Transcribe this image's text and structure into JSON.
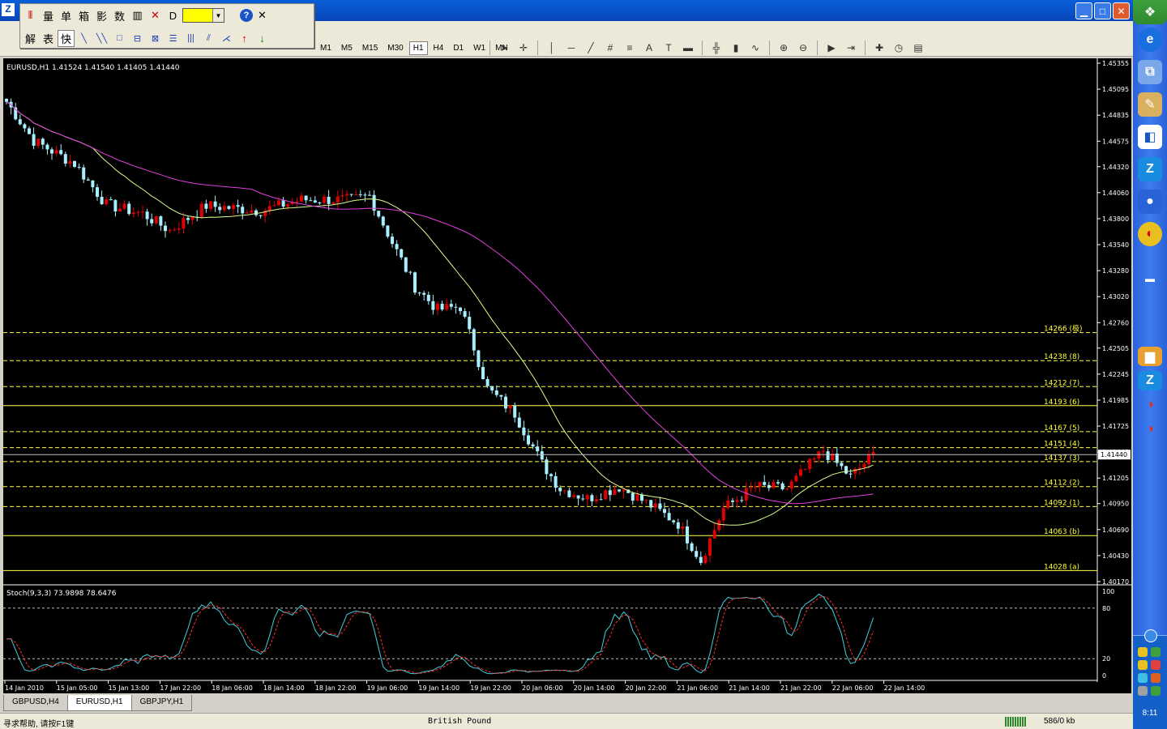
{
  "floating_toolbar": {
    "row1": [
      "量",
      "单",
      "箱",
      "影",
      "数"
    ],
    "row2": [
      "解",
      "表",
      "快"
    ],
    "help": "?",
    "close": "✕"
  },
  "timeframes": [
    "M1",
    "M5",
    "M15",
    "M30",
    "H1",
    "H4",
    "D1",
    "W1",
    "MN"
  ],
  "active_timeframe": "H1",
  "chart": {
    "label": "EURUSD,H1  1.41524 1.41540 1.41405 1.41440",
    "current_price": 1.4144,
    "current_price_label": "1.41440",
    "price_axis": [
      "1.45355",
      "1.45095",
      "1.44835",
      "1.44575",
      "1.44320",
      "1.44060",
      "1.43800",
      "1.43540",
      "1.43280",
      "1.43020",
      "1.42760",
      "1.42505",
      "1.42245",
      "1.41985",
      "1.41725",
      "1.41465",
      "1.41205",
      "1.40950",
      "1.40690",
      "1.40430",
      "1.40170"
    ],
    "price_axis_values": [
      1.45355,
      1.45095,
      1.44835,
      1.44575,
      1.4432,
      1.4406,
      1.438,
      1.4354,
      1.4328,
      1.4302,
      1.4276,
      1.42505,
      1.42245,
      1.41985,
      1.41725,
      1.41465,
      1.41205,
      1.4095,
      1.4069,
      1.4043,
      1.4017
    ],
    "time_axis": [
      "14 Jan 2010",
      "15 Jan 05:00",
      "15 Jan 13:00",
      "17 Jan 22:00",
      "18 Jan 06:00",
      "18 Jan 14:00",
      "18 Jan 22:00",
      "19 Jan 06:00",
      "19 Jan 14:00",
      "19 Jan 22:00",
      "20 Jan 06:00",
      "20 Jan 14:00",
      "20 Jan 22:00",
      "21 Jan 06:00",
      "21 Jan 14:00",
      "21 Jan 22:00",
      "22 Jan 06:00",
      "22 Jan 14:00"
    ],
    "levels": [
      {
        "price": 1.4266,
        "label": "14266 (极)",
        "style": "dash"
      },
      {
        "price": 1.4238,
        "label": "14238 (8)",
        "style": "dash"
      },
      {
        "price": 1.4212,
        "label": "14212 (7)",
        "style": "dash"
      },
      {
        "price": 1.4193,
        "label": "14193 (6)",
        "style": "solid"
      },
      {
        "price": 1.4167,
        "label": "14167 (5)",
        "style": "dash"
      },
      {
        "price": 1.4151,
        "label": "14151 (4)",
        "style": "dash"
      },
      {
        "price": 1.4137,
        "label": "14137 (3)",
        "style": "dash"
      },
      {
        "price": 1.4112,
        "label": "14112 (2)",
        "style": "dash"
      },
      {
        "price": 1.4092,
        "label": "14092 (1)",
        "style": "dash"
      },
      {
        "price": 1.4063,
        "label": "14063 (b)",
        "style": "solid"
      },
      {
        "price": 1.4028,
        "label": "14028 (a)",
        "style": "solid"
      }
    ],
    "colors": {
      "bull": "#e00000",
      "bear": "#a8f0ff",
      "ma_fast": "#d8ff90",
      "ma_slow": "#e040e0",
      "level": "#ffff40",
      "stoch_main": "#40d0e0",
      "stoch_signal": "#ff3030"
    }
  },
  "stoch": {
    "label": "Stoch(9,3,3) 73.9898 78.6476",
    "axis": [
      "100",
      "80",
      "20",
      "0"
    ],
    "axis_values": [
      100,
      80,
      20,
      0
    ]
  },
  "tabs": [
    {
      "label": "GBPUSD,H4",
      "active": false
    },
    {
      "label": "EURUSD,H1",
      "active": true
    },
    {
      "label": "GBPJPY,H1",
      "active": false
    }
  ],
  "status": {
    "help": "寻求帮助, 请按F1键",
    "profile": "British Pound",
    "traffic": "586/0 kb"
  },
  "taskbar": {
    "clock": "8:11"
  }
}
